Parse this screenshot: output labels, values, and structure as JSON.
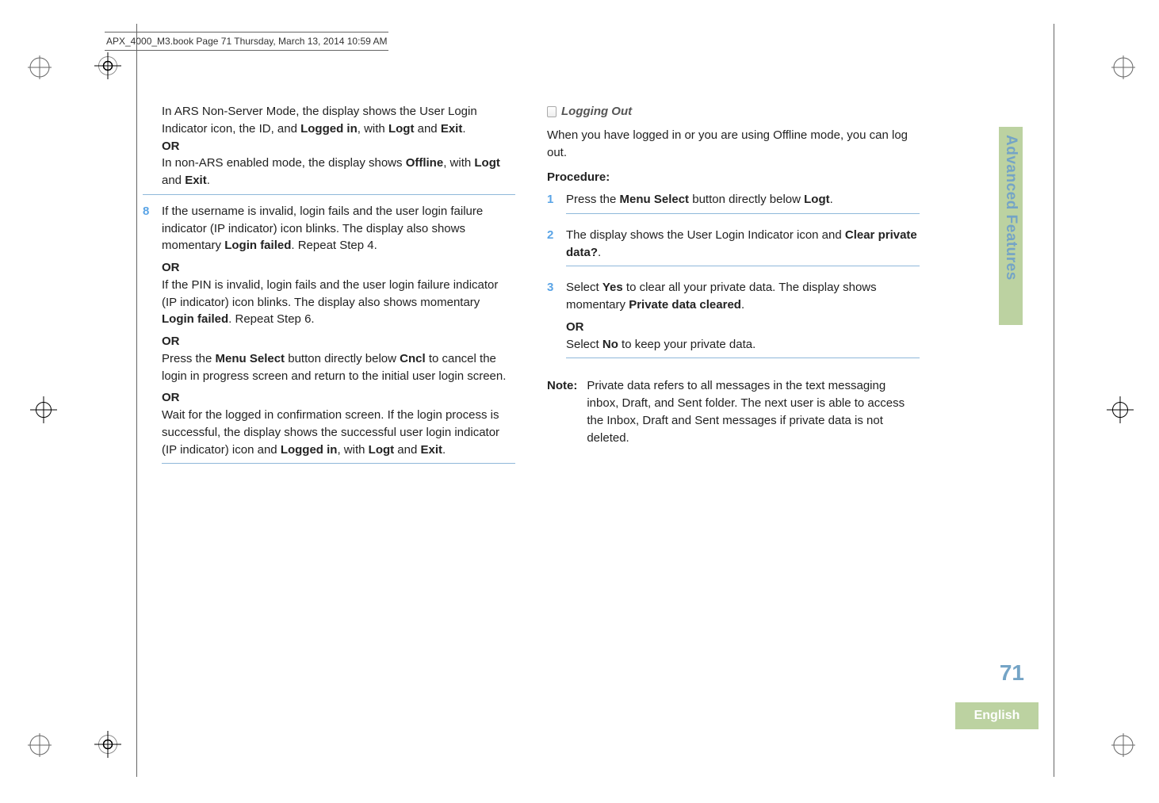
{
  "book_header": "APX_4000_M3.book  Page 71  Thursday, March 13, 2014  10:59 AM",
  "left_col": {
    "p1_a": "In ARS Non-Server Mode, the display shows the User Login Indicator icon, the ID, and ",
    "p1_logged_in": "Logged in",
    "p1_b": ", with ",
    "p1_logt": "Logt",
    "p1_c": " and ",
    "p1_exit": "Exit",
    "p1_d": ".",
    "or": "OR",
    "p2_a": "In non-ARS enabled mode, the display shows ",
    "p2_offline": "Offline",
    "p2_b": ", with ",
    "p2_logt": "Logt",
    "p2_c": " and ",
    "p2_exit": "Exit",
    "p2_d": ".",
    "step8_num": "8",
    "s8_p1_a": "If the username is invalid, login fails and the user login failure indicator (IP indicator) icon blinks. The display also shows momentary ",
    "s8_p1_login_failed": "Login failed",
    "s8_p1_b": ". Repeat Step 4.",
    "s8_p2_a": "If the PIN is invalid, login fails and the user login failure indicator (IP indicator) icon blinks. The display also shows momentary ",
    "s8_p2_login_failed": "Login failed",
    "s8_p2_b": ". Repeat Step 6.",
    "s8_p3_a": "Press the ",
    "s8_p3_menu": "Menu Select",
    "s8_p3_b": " button directly below ",
    "s8_p3_cncl": "Cncl",
    "s8_p3_c": " to cancel the login in progress screen and return to the initial user login screen.",
    "s8_p4_a": "Wait for the logged in confirmation screen. If the login process is successful, the display shows the successful user login indicator (IP indicator) icon and ",
    "s8_p4_logged_in": "Logged in",
    "s8_p4_b": ", with ",
    "s8_p4_logt": "Logt",
    "s8_p4_c": " and ",
    "s8_p4_exit": "Exit",
    "s8_p4_d": "."
  },
  "right_col": {
    "heading": "Logging Out",
    "intro": "When you have logged in or you are using Offline mode, you can log out.",
    "procedure_label": "Procedure:",
    "step1_num": "1",
    "s1_a": "Press the ",
    "s1_menu": "Menu Select",
    "s1_b": " button directly below ",
    "s1_logt": "Logt",
    "s1_c": ".",
    "step2_num": "2",
    "s2_a": "The display shows the User Login Indicator icon and ",
    "s2_clear": "Clear private data?",
    "s2_b": ".",
    "step3_num": "3",
    "s3_a": "Select ",
    "s3_yes": "Yes",
    "s3_b": " to clear all your private data. The display shows momentary ",
    "s3_cleared": "Private data cleared",
    "s3_c": ".",
    "or": "OR",
    "s3_d": "Select ",
    "s3_no": "No",
    "s3_e": " to keep your private data.",
    "note_label": "Note:",
    "note_body": "Private data refers to all messages in the text messaging inbox, Draft, and Sent folder. The next user is able to access the Inbox, Draft and Sent messages if private data is not deleted."
  },
  "sidebar": {
    "tab": "Advanced Features",
    "page_number": "71",
    "language": "English"
  }
}
